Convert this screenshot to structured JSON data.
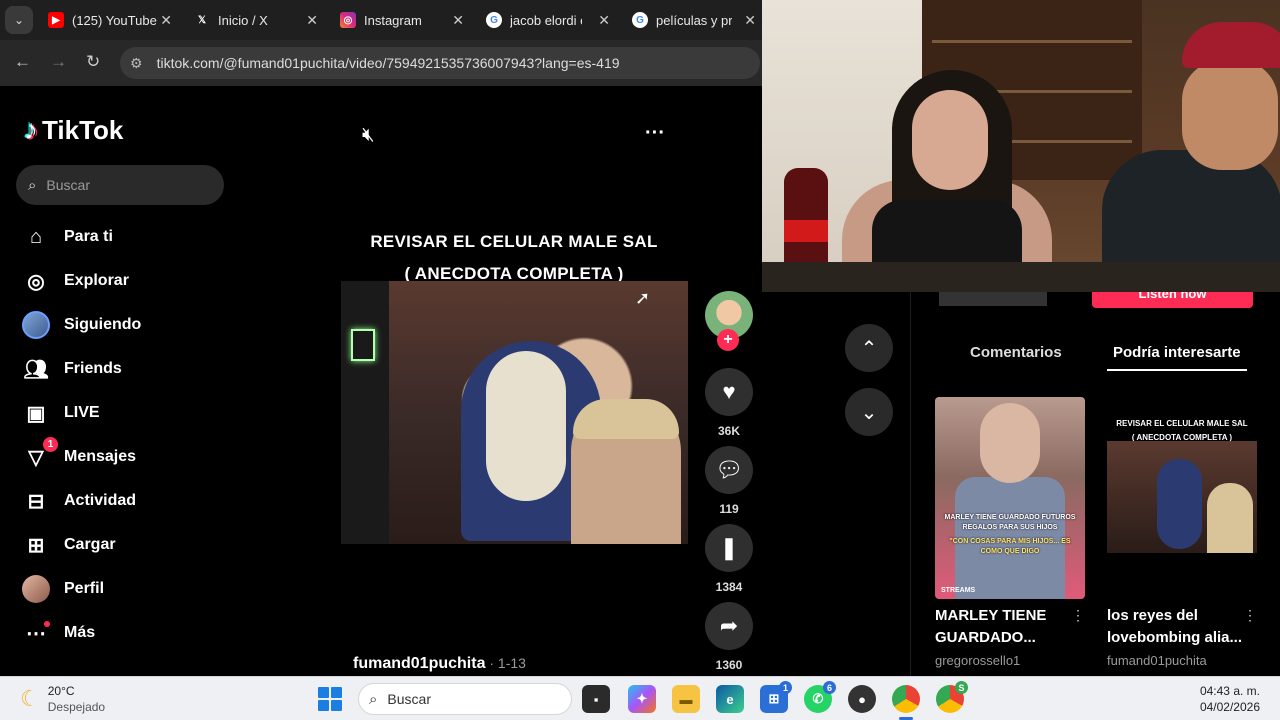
{
  "browser": {
    "tabs": [
      {
        "title": "(125) YouTube",
        "icon": "youtube-icon",
        "color": "#ff0000"
      },
      {
        "title": "Inicio / X",
        "icon": "x-icon",
        "color": "#000000"
      },
      {
        "title": "Instagram",
        "icon": "instagram-icon",
        "color": "#d6249f"
      },
      {
        "title": "jacob elordi e",
        "icon": "google-icon",
        "color": "#4285f4"
      },
      {
        "title": "películas y pro",
        "icon": "google-icon",
        "color": "#4285f4"
      }
    ],
    "url": "tiktok.com/@fumand01puchita/video/7594921535736007943?lang=es-419"
  },
  "tiktok": {
    "logo": "TikTok",
    "search_placeholder": "Buscar",
    "nav": [
      {
        "label": "Para ti",
        "icon": "home-icon"
      },
      {
        "label": "Explorar",
        "icon": "compass-icon"
      },
      {
        "label": "Siguiendo",
        "icon": "following-avatar-icon"
      },
      {
        "label": "Friends",
        "icon": "friends-icon"
      },
      {
        "label": "LIVE",
        "icon": "live-icon"
      },
      {
        "label": "Mensajes",
        "icon": "messages-icon",
        "badge": "1"
      },
      {
        "label": "Actividad",
        "icon": "activity-icon"
      },
      {
        "label": "Cargar",
        "icon": "upload-icon"
      },
      {
        "label": "Perfil",
        "icon": "profile-avatar-icon"
      },
      {
        "label": "Más",
        "icon": "more-icon"
      }
    ],
    "video": {
      "caption_line1": "REVISAR EL CELULAR MALE SAL",
      "caption_line2": "( ANECDOTA COMPLETA )",
      "author": "fumand01puchita",
      "meta": " · 1-13",
      "likes": "36K",
      "comments": "119",
      "saves": "1384",
      "shares": "1360"
    },
    "right": {
      "listen_now": "Listen now",
      "tabs": [
        "Comentarios",
        "Podría interesarte"
      ],
      "active_tab": "Podría interesarte",
      "cards": [
        {
          "title": "MARLEY TIENE GUARDADO...",
          "user": "gregorossello1",
          "overlay1": "MARLEY TIENE GUARDADO FUTUROS REGALOS PARA SUS HIJOS",
          "overlay2": "\"CON COSAS PARA MIS HIJOS... ES COMO QUE DIGO",
          "overlay3": "STREAMS"
        },
        {
          "title": "los reyes del lovebombing alia...",
          "user": "fumand01puchita",
          "overlay1": "REVISAR EL CELULAR MALE SAL",
          "overlay2": "( ANECDOTA COMPLETA )"
        }
      ]
    }
  },
  "taskbar": {
    "weather_temp": "20°C",
    "weather_desc": "Despejado",
    "search_placeholder": "Buscar",
    "time": "04:43 a. m.",
    "date": "04/02/2026",
    "badges": {
      "store": "1",
      "whatsapp": "6",
      "chrome_profile": "S"
    }
  }
}
